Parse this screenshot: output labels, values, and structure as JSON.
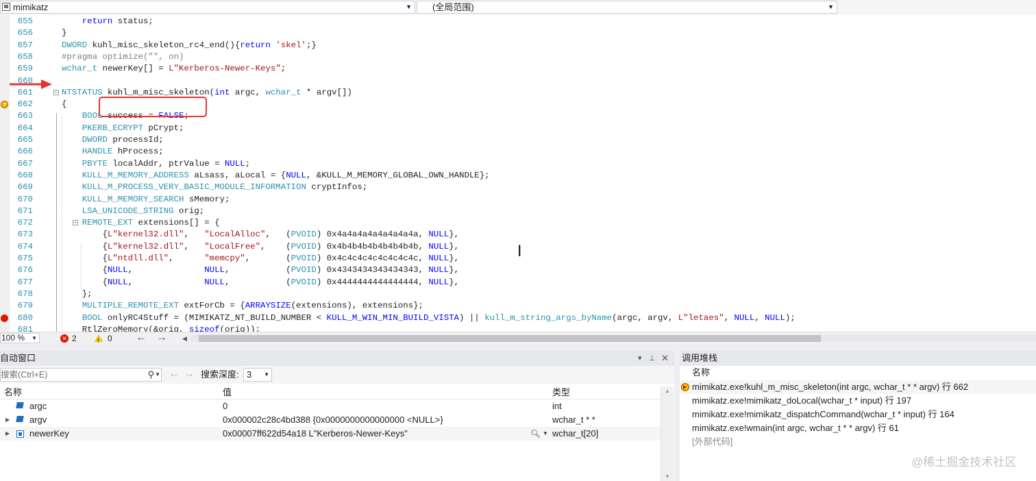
{
  "navbar": {
    "project": "mimikatz",
    "scope": "(全局范围)"
  },
  "editor": {
    "lines": [
      {
        "n": "655",
        "tokens": [
          [
            "nm",
            "    "
          ],
          [
            "kw",
            "return"
          ],
          [
            "nm",
            " status;"
          ]
        ]
      },
      {
        "n": "656",
        "tokens": [
          [
            "nm",
            "}"
          ]
        ]
      },
      {
        "n": "657",
        "tokens": [
          [
            "ty",
            "DWORD"
          ],
          [
            "nm",
            " kuhl_misc_skeleton_rc4_end(){"
          ],
          [
            "kw",
            "return"
          ],
          [
            "nm",
            " "
          ],
          [
            "st",
            "'skel'"
          ],
          [
            "nm",
            ";}"
          ]
        ]
      },
      {
        "n": "658",
        "tokens": [
          [
            "pp",
            "#pragma optimize(\"\", on)"
          ]
        ]
      },
      {
        "n": "659",
        "tokens": [
          [
            "ty",
            "wchar_t"
          ],
          [
            "nm",
            " newerKey[] = "
          ],
          [
            "st",
            "L\"Kerberos-Newer-Keys\""
          ],
          [
            "nm",
            ";"
          ]
        ]
      },
      {
        "n": "660",
        "tokens": []
      },
      {
        "n": "661",
        "tokens": [
          [
            "ty",
            "NTSTATUS"
          ],
          [
            "nm",
            " kuhl_m_misc_skeleton("
          ],
          [
            "kw",
            "int"
          ],
          [
            "nm",
            " argc, "
          ],
          [
            "ty",
            "wchar_t"
          ],
          [
            "nm",
            " * argv[])"
          ]
        ]
      },
      {
        "n": "662",
        "tokens": [
          [
            "nm",
            "{"
          ]
        ]
      },
      {
        "n": "663",
        "tokens": [
          [
            "nm",
            "    "
          ],
          [
            "ty",
            "BOOL"
          ],
          [
            "nm",
            " success = "
          ],
          [
            "kw",
            "FALSE"
          ],
          [
            "nm",
            ";"
          ]
        ]
      },
      {
        "n": "664",
        "tokens": [
          [
            "nm",
            "    "
          ],
          [
            "ty",
            "PKERB_ECRYPT"
          ],
          [
            "nm",
            " pCrypt;"
          ]
        ]
      },
      {
        "n": "665",
        "tokens": [
          [
            "nm",
            "    "
          ],
          [
            "ty",
            "DWORD"
          ],
          [
            "nm",
            " processId;"
          ]
        ]
      },
      {
        "n": "666",
        "tokens": [
          [
            "nm",
            "    "
          ],
          [
            "ty",
            "HANDLE"
          ],
          [
            "nm",
            " hProcess;"
          ]
        ]
      },
      {
        "n": "667",
        "tokens": [
          [
            "nm",
            "    "
          ],
          [
            "ty",
            "PBYTE"
          ],
          [
            "nm",
            " localAddr, ptrValue = "
          ],
          [
            "kw",
            "NULL"
          ],
          [
            "nm",
            ";"
          ]
        ]
      },
      {
        "n": "668",
        "tokens": [
          [
            "nm",
            "    "
          ],
          [
            "ty",
            "KULL_M_MEMORY_ADDRESS"
          ],
          [
            "nm",
            " aLsass, aLocal = {"
          ],
          [
            "kw",
            "NULL"
          ],
          [
            "nm",
            ", &KULL_M_MEMORY_GLOBAL_OWN_HANDLE};"
          ]
        ]
      },
      {
        "n": "669",
        "tokens": [
          [
            "nm",
            "    "
          ],
          [
            "ty",
            "KULL_M_PROCESS_VERY_BASIC_MODULE_INFORMATION"
          ],
          [
            "nm",
            " cryptInfos;"
          ]
        ]
      },
      {
        "n": "670",
        "tokens": [
          [
            "nm",
            "    "
          ],
          [
            "ty",
            "KULL_M_MEMORY_SEARCH"
          ],
          [
            "nm",
            " sMemory;"
          ]
        ]
      },
      {
        "n": "671",
        "tokens": [
          [
            "nm",
            "    "
          ],
          [
            "ty",
            "LSA_UNICODE_STRING"
          ],
          [
            "nm",
            " orig;"
          ]
        ]
      },
      {
        "n": "672",
        "tokens": [
          [
            "nm",
            "    "
          ],
          [
            "ty",
            "REMOTE_EXT"
          ],
          [
            "nm",
            " extensions[] = {"
          ]
        ]
      },
      {
        "n": "673",
        "tokens": [
          [
            "nm",
            "        {"
          ],
          [
            "st",
            "L\"kernel32.dll\""
          ],
          [
            "nm",
            ",   "
          ],
          [
            "st",
            "\"LocalAlloc\""
          ],
          [
            "nm",
            ",   ("
          ],
          [
            "ty",
            "PVOID"
          ],
          [
            "nm",
            ") 0x4a4a4a4a4a4a4a4a, "
          ],
          [
            "kw",
            "NULL"
          ],
          [
            "nm",
            "},"
          ]
        ]
      },
      {
        "n": "674",
        "tokens": [
          [
            "nm",
            "        {"
          ],
          [
            "st",
            "L\"kernel32.dll\""
          ],
          [
            "nm",
            ",   "
          ],
          [
            "st",
            "\"LocalFree\""
          ],
          [
            "nm",
            ",    ("
          ],
          [
            "ty",
            "PVOID"
          ],
          [
            "nm",
            ") 0x4b4b4b4b4b4b4b4b, "
          ],
          [
            "kw",
            "NULL"
          ],
          [
            "nm",
            "},"
          ]
        ]
      },
      {
        "n": "675",
        "tokens": [
          [
            "nm",
            "        {"
          ],
          [
            "st",
            "L\"ntdll.dll\""
          ],
          [
            "nm",
            ",      "
          ],
          [
            "st",
            "\"memcpy\""
          ],
          [
            "nm",
            ",       ("
          ],
          [
            "ty",
            "PVOID"
          ],
          [
            "nm",
            ") 0x4c4c4c4c4c4c4c4c, "
          ],
          [
            "kw",
            "NULL"
          ],
          [
            "nm",
            "},"
          ]
        ]
      },
      {
        "n": "676",
        "tokens": [
          [
            "nm",
            "        {"
          ],
          [
            "kw",
            "NULL"
          ],
          [
            "nm",
            ",              "
          ],
          [
            "kw",
            "NULL"
          ],
          [
            "nm",
            ",           ("
          ],
          [
            "ty",
            "PVOID"
          ],
          [
            "nm",
            ") 0x4343434343434343, "
          ],
          [
            "kw",
            "NULL"
          ],
          [
            "nm",
            "},"
          ]
        ]
      },
      {
        "n": "677",
        "tokens": [
          [
            "nm",
            "        {"
          ],
          [
            "kw",
            "NULL"
          ],
          [
            "nm",
            ",              "
          ],
          [
            "kw",
            "NULL"
          ],
          [
            "nm",
            ",           ("
          ],
          [
            "ty",
            "PVOID"
          ],
          [
            "nm",
            ") 0x4444444444444444, "
          ],
          [
            "kw",
            "NULL"
          ],
          [
            "nm",
            "},"
          ]
        ]
      },
      {
        "n": "678",
        "tokens": [
          [
            "nm",
            "    };"
          ]
        ]
      },
      {
        "n": "679",
        "tokens": [
          [
            "nm",
            "    "
          ],
          [
            "ty",
            "MULTIPLE_REMOTE_EXT"
          ],
          [
            "nm",
            " extForCb = {"
          ],
          [
            "kw",
            "ARRAYSIZE"
          ],
          [
            "nm",
            "(extensions), extensions};"
          ]
        ]
      },
      {
        "n": "680",
        "tokens": [
          [
            "nm",
            "    "
          ],
          [
            "ty",
            "BOOL"
          ],
          [
            "nm",
            " onlyRC4Stuff = (MIMIKATZ_NT_BUILD_NUMBER < "
          ],
          [
            "kw",
            "KULL_M_WIN_MIN_BUILD_VISTA"
          ],
          [
            "nm",
            ") || "
          ],
          [
            "ty",
            "kull_m_string_args_byName"
          ],
          [
            "nm",
            "(argc, argv, "
          ],
          [
            "st",
            "L\"letaes\""
          ],
          [
            "nm",
            ", "
          ],
          [
            "kw",
            "NULL"
          ],
          [
            "nm",
            ", "
          ],
          [
            "kw",
            "NULL"
          ],
          [
            "nm",
            ");"
          ]
        ]
      },
      {
        "n": "681",
        "tokens": [
          [
            "nm",
            "    RtlZeroMemory(&orig, "
          ],
          [
            "kw",
            "sizeof"
          ],
          [
            "nm",
            "(orig));"
          ]
        ]
      }
    ],
    "breakpoint_line": "680",
    "instruction_pointer_line": "662",
    "highlighted_function": "kuhl_m_misc_skeleton"
  },
  "status_bar": {
    "zoom": "100 %",
    "errors": "2",
    "warnings": "0"
  },
  "autos": {
    "title": "自动窗口",
    "search_placeholder": "搜索(Ctrl+E)",
    "depth_label": "搜索深度:",
    "depth_value": "3",
    "columns": [
      "名称",
      "值",
      "类型"
    ],
    "rows": [
      {
        "name": "argc",
        "value": "0",
        "type": "int",
        "expandable": false
      },
      {
        "name": "argv",
        "value": "0x000002c28c4bd388 {0x0000000000000000 <NULL>}",
        "type": "wchar_t * *",
        "expandable": true
      },
      {
        "name": "newerKey",
        "value": "0x00007ff622d54a18 L\"Kerberos-Newer-Keys\"",
        "type": "wchar_t[20]",
        "expandable": true
      }
    ]
  },
  "callstack": {
    "title": "调用堆栈",
    "column": "名称",
    "frames": [
      "mimikatz.exe!kuhl_m_misc_skeleton(int argc, wchar_t * * argv) 行 662",
      "mimikatz.exe!mimikatz_doLocal(wchar_t * input) 行 197",
      "mimikatz.exe!mimikatz_dispatchCommand(wchar_t * input) 行 164",
      "mimikatz.exe!wmain(int argc, wchar_t * * argv) 行 61",
      "[外部代码]"
    ]
  },
  "watermark": "@稀土掘金技术社区",
  "colors": {
    "keyword": "#0000ff",
    "type": "#2b91af",
    "string": "#a31515",
    "annotation_red": "#e8332e",
    "breakpoint": "#e51400"
  }
}
